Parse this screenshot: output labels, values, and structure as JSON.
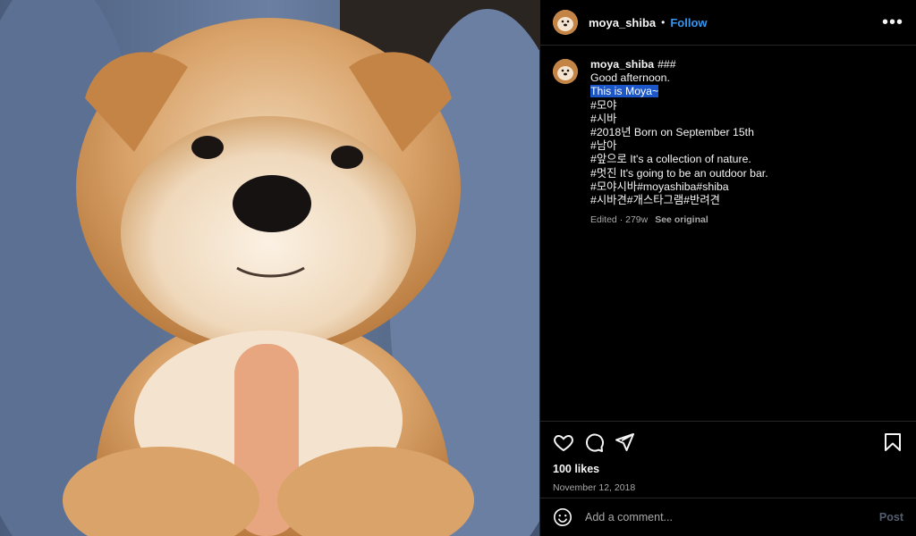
{
  "post": {
    "username": "moya_shiba",
    "follow_label": "Follow",
    "separator": "•",
    "more_label": "•••",
    "image_alt": "Shiba puppy lying on a person's lap holding a finger"
  },
  "caption": {
    "username": "moya_shiba",
    "lines": [
      "###",
      "Good afternoon.",
      "This is Moya~",
      "#모야",
      "#시바",
      "#2018년 Born on September 15th",
      "#남아",
      "#앞으로 It's a collection of nature.",
      "#멋진 It's going to be an outdoor bar.",
      "#모야시바#moyashiba#shiba",
      "#시바견#개스타그램#반려견"
    ],
    "edited": "Edited · 279w",
    "see_original": "See original"
  },
  "stats": {
    "likes": "100 likes",
    "date": "November 12, 2018"
  },
  "comment": {
    "placeholder": "Add a comment...",
    "post_label": "Post"
  },
  "icons": {
    "like": "heart-icon",
    "comment": "comment-icon",
    "share": "share-icon",
    "save": "bookmark-icon",
    "emoji": "emoji-icon"
  },
  "colors": {
    "background": "#000000",
    "accent": "#3897f0",
    "highlight": "#1c57c9",
    "muted": "#a8a8a8"
  }
}
